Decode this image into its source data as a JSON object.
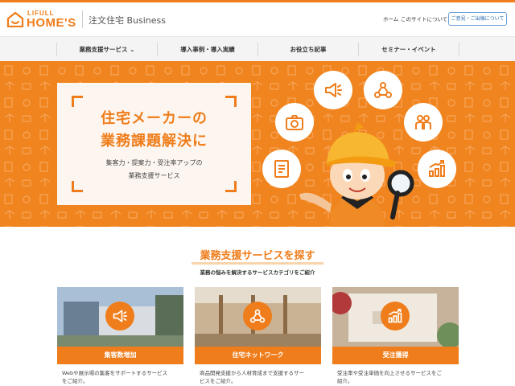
{
  "header": {
    "logo_small": "LIFULL",
    "logo_big": "HOME'S",
    "business": "注文住宅 Business",
    "links": [
      "ホーム",
      "このサイトについて"
    ],
    "cta_button": "ご意見・ご出稿について"
  },
  "nav": {
    "items": [
      "業務支援サービス ⌄",
      "導入事例・導入実績",
      "お役立ち記事",
      "セミナー・イベント"
    ]
  },
  "hero": {
    "title_line1": "住宅メーカーの",
    "title_line2": "業務課題解決に",
    "sub_line1": "集客力・提案力・受注率アップの",
    "sub_line2": "業務支援サービス",
    "icons": [
      "megaphone-icon",
      "network-icon",
      "camera-icon",
      "people-icon",
      "document-icon",
      "growth-chart-icon"
    ]
  },
  "section": {
    "title": "業務支援サービスを探す",
    "subtitle": "業務の悩みを解決するサービスカテゴリをご紹介"
  },
  "cards": [
    {
      "label": "集客数増加",
      "desc_line1": "Webや展示場の集客をサポートするサービス",
      "desc_line2": "をご紹介。",
      "icon": "megaphone-icon"
    },
    {
      "label": "住宅ネットワーク",
      "desc_line1": "商品開発支援から人材育成まで支援するサー",
      "desc_line2": "ビスをご紹介。",
      "icon": "network-icon"
    },
    {
      "label": "受注獲得",
      "desc_line1": "受注率や受注単価を向上させるサービスをご",
      "desc_line2": "紹介。",
      "icon": "growth-chart-icon"
    }
  ],
  "colors": {
    "brand_orange": "#ef7d1b",
    "hero_bg": "#f0841f",
    "nav_bg": "#f4f4f4",
    "card_photo_1": "#8fa6bf",
    "card_photo_2": "#b79d7a",
    "card_photo_3": "#b8a48e"
  }
}
